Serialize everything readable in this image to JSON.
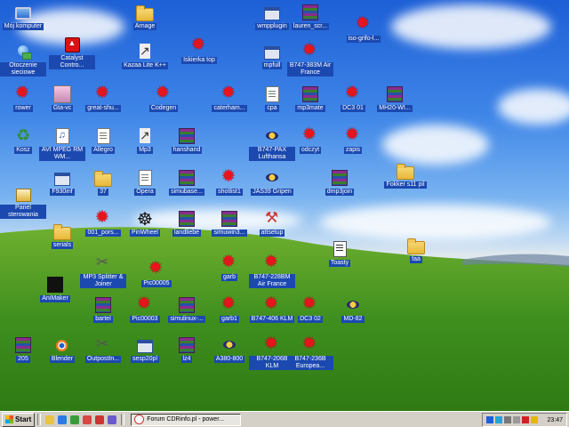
{
  "desktop": {
    "icons": [
      {
        "name": "icon-moj-komputer",
        "label": "Mój komputer",
        "glyph": "pc",
        "selected": true
      },
      {
        "name": "icon-arnage",
        "label": "Arnage",
        "glyph": "folder"
      },
      {
        "name": "icon-wmpplugin",
        "label": "wmpplugin",
        "glyph": "exe"
      },
      {
        "name": "icon-lauren-scr",
        "label": "lauren_scr...",
        "glyph": "rar"
      },
      {
        "name": "icon-iso-grifo",
        "label": "iso-grifo-l...",
        "glyph": "star"
      },
      {
        "name": "icon-otoczenie-sieciowe",
        "label": "Otoczenie sieciowe",
        "glyph": "net"
      },
      {
        "name": "icon-catalyst-control",
        "label": "Catalyst Contro...",
        "glyph": "ati"
      },
      {
        "name": "icon-kazaa-lite",
        "label": "Kazaa Lite K++",
        "glyph": "shortcut"
      },
      {
        "name": "icon-iskierka-top",
        "label": "Iskierka top",
        "glyph": "star"
      },
      {
        "name": "icon-mpfull",
        "label": "mpfull",
        "glyph": "exe"
      },
      {
        "name": "icon-b747-383m-air-france",
        "label": "B747-383M Air France",
        "glyph": "star"
      },
      {
        "name": "icon-rower",
        "label": "rower",
        "glyph": "star"
      },
      {
        "name": "icon-gta-vc",
        "label": "Gta-vc",
        "glyph": "anime"
      },
      {
        "name": "icon-great-shu",
        "label": "great-shu...",
        "glyph": "star"
      },
      {
        "name": "icon-codegen",
        "label": "Codegen",
        "glyph": "star"
      },
      {
        "name": "icon-caterham",
        "label": "caterham...",
        "glyph": "star"
      },
      {
        "name": "icon-cpa",
        "label": "cpa",
        "glyph": "doc"
      },
      {
        "name": "icon-mp3mate",
        "label": "mp3mate",
        "glyph": "rar"
      },
      {
        "name": "icon-dc3-01",
        "label": "DC3 01",
        "glyph": "star"
      },
      {
        "name": "icon-mh20-wi",
        "label": "MH20-WI...",
        "glyph": "rar"
      },
      {
        "name": "icon-kosz",
        "label": "Kosz",
        "glyph": "recycle"
      },
      {
        "name": "icon-avi-mpeg",
        "label": "AVI MPEG RM WM...",
        "glyph": "media"
      },
      {
        "name": "icon-allegro",
        "label": "Allegro",
        "glyph": "doc"
      },
      {
        "name": "icon-mp3",
        "label": "Mp3",
        "glyph": "shortcut"
      },
      {
        "name": "icon-hanshand",
        "label": "hanshand",
        "glyph": "rar"
      },
      {
        "name": "icon-b747-pax-lufthansa",
        "label": "B747-PAX Lufthansa",
        "glyph": "plane"
      },
      {
        "name": "icon-odczyt",
        "label": "odczyt",
        "glyph": "star"
      },
      {
        "name": "icon-zapis",
        "label": "zapis",
        "glyph": "star"
      },
      {
        "name": "icon-f930inf",
        "label": "F930inf",
        "glyph": "exe"
      },
      {
        "name": "icon-37",
        "label": "37",
        "glyph": "folder"
      },
      {
        "name": "icon-opera",
        "label": "Opera",
        "glyph": "doc"
      },
      {
        "name": "icon-simubase",
        "label": "simubase...",
        "glyph": "rar"
      },
      {
        "name": "icon-shotlist1",
        "label": "shotlist1",
        "glyph": "star"
      },
      {
        "name": "icon-jas39-gripen",
        "label": "JAS39 Gripen",
        "glyph": "plane"
      },
      {
        "name": "icon-dmp3join",
        "label": "dmp3join",
        "glyph": "rar"
      },
      {
        "name": "icon-fokker-s11-pil",
        "label": "Fokker s11 pil",
        "glyph": "folder"
      },
      {
        "name": "icon-panel-sterowania",
        "label": "Panel sterowania",
        "glyph": "panel"
      },
      {
        "name": "icon-serials",
        "label": "serials",
        "glyph": "folder"
      },
      {
        "name": "icon-001-pors",
        "label": "001_pors...",
        "glyph": "star"
      },
      {
        "name": "icon-pinwheel",
        "label": "PinWheel",
        "glyph": "pinwheel"
      },
      {
        "name": "icon-landliebe",
        "label": "landliebe",
        "glyph": "rar"
      },
      {
        "name": "icon-simuwin3",
        "label": "simuwin3...",
        "glyph": "rar"
      },
      {
        "name": "icon-attsetup",
        "label": "attsetup",
        "glyph": "attsetup"
      },
      {
        "name": "icon-toasty",
        "label": "Toasty",
        "glyph": "toast"
      },
      {
        "name": "icon-faa",
        "label": "faa",
        "glyph": "folder"
      },
      {
        "name": "icon-mp3-splitter",
        "label": "MP3 Splitter & Joiner",
        "glyph": "scissors"
      },
      {
        "name": "icon-pic00005",
        "label": "Pic00005",
        "glyph": "star"
      },
      {
        "name": "icon-garb",
        "label": "garb",
        "glyph": "star"
      },
      {
        "name": "icon-b747-228bm-air-france",
        "label": "B747-228BM Air France",
        "glyph": "star"
      },
      {
        "name": "icon-animaker",
        "label": "AniMaker",
        "glyph": "3d"
      },
      {
        "name": "icon-bartel",
        "label": "bartel",
        "glyph": "rar"
      },
      {
        "name": "icon-pic00003",
        "label": "Pic00003",
        "glyph": "star"
      },
      {
        "name": "icon-simulinux",
        "label": "simulinux-...",
        "glyph": "rar"
      },
      {
        "name": "icon-garb1",
        "label": "garb1",
        "glyph": "star"
      },
      {
        "name": "icon-b747-406-klm",
        "label": "B747-406 KLM",
        "glyph": "star"
      },
      {
        "name": "icon-dc3-02",
        "label": "DC3 02",
        "glyph": "star"
      },
      {
        "name": "icon-md-82",
        "label": "MD-82",
        "glyph": "plane"
      },
      {
        "name": "icon-205",
        "label": "205",
        "glyph": "rar"
      },
      {
        "name": "icon-blender",
        "label": "Blender",
        "glyph": "blender"
      },
      {
        "name": "icon-outpostin",
        "label": "OutpostIn...",
        "glyph": "scissors"
      },
      {
        "name": "icon-sesp20pl",
        "label": "sesp20pl",
        "glyph": "exe"
      },
      {
        "name": "icon-lz4",
        "label": "lz4",
        "glyph": "rar"
      },
      {
        "name": "icon-a380-800",
        "label": "A380-800",
        "glyph": "plane"
      },
      {
        "name": "icon-b747-206b-klm",
        "label": "B747-206B KLM",
        "glyph": "star"
      },
      {
        "name": "icon-b747-236b-europea",
        "label": "B747-236B Europea...",
        "glyph": "star"
      }
    ]
  },
  "taskbar": {
    "start_label": "Start",
    "task_label": "Forum CDRinfo.pl - power...",
    "clock": "23:47",
    "quicklaunch": [
      "explorer-icon",
      "ie-icon",
      "wmp-icon",
      "outlook-icon",
      "opera-icon",
      "media-icon"
    ],
    "tray": [
      "pl-icon",
      "network-icon",
      "shield-icon",
      "volume-icon",
      "antivirus-icon",
      "flag-icon"
    ]
  }
}
